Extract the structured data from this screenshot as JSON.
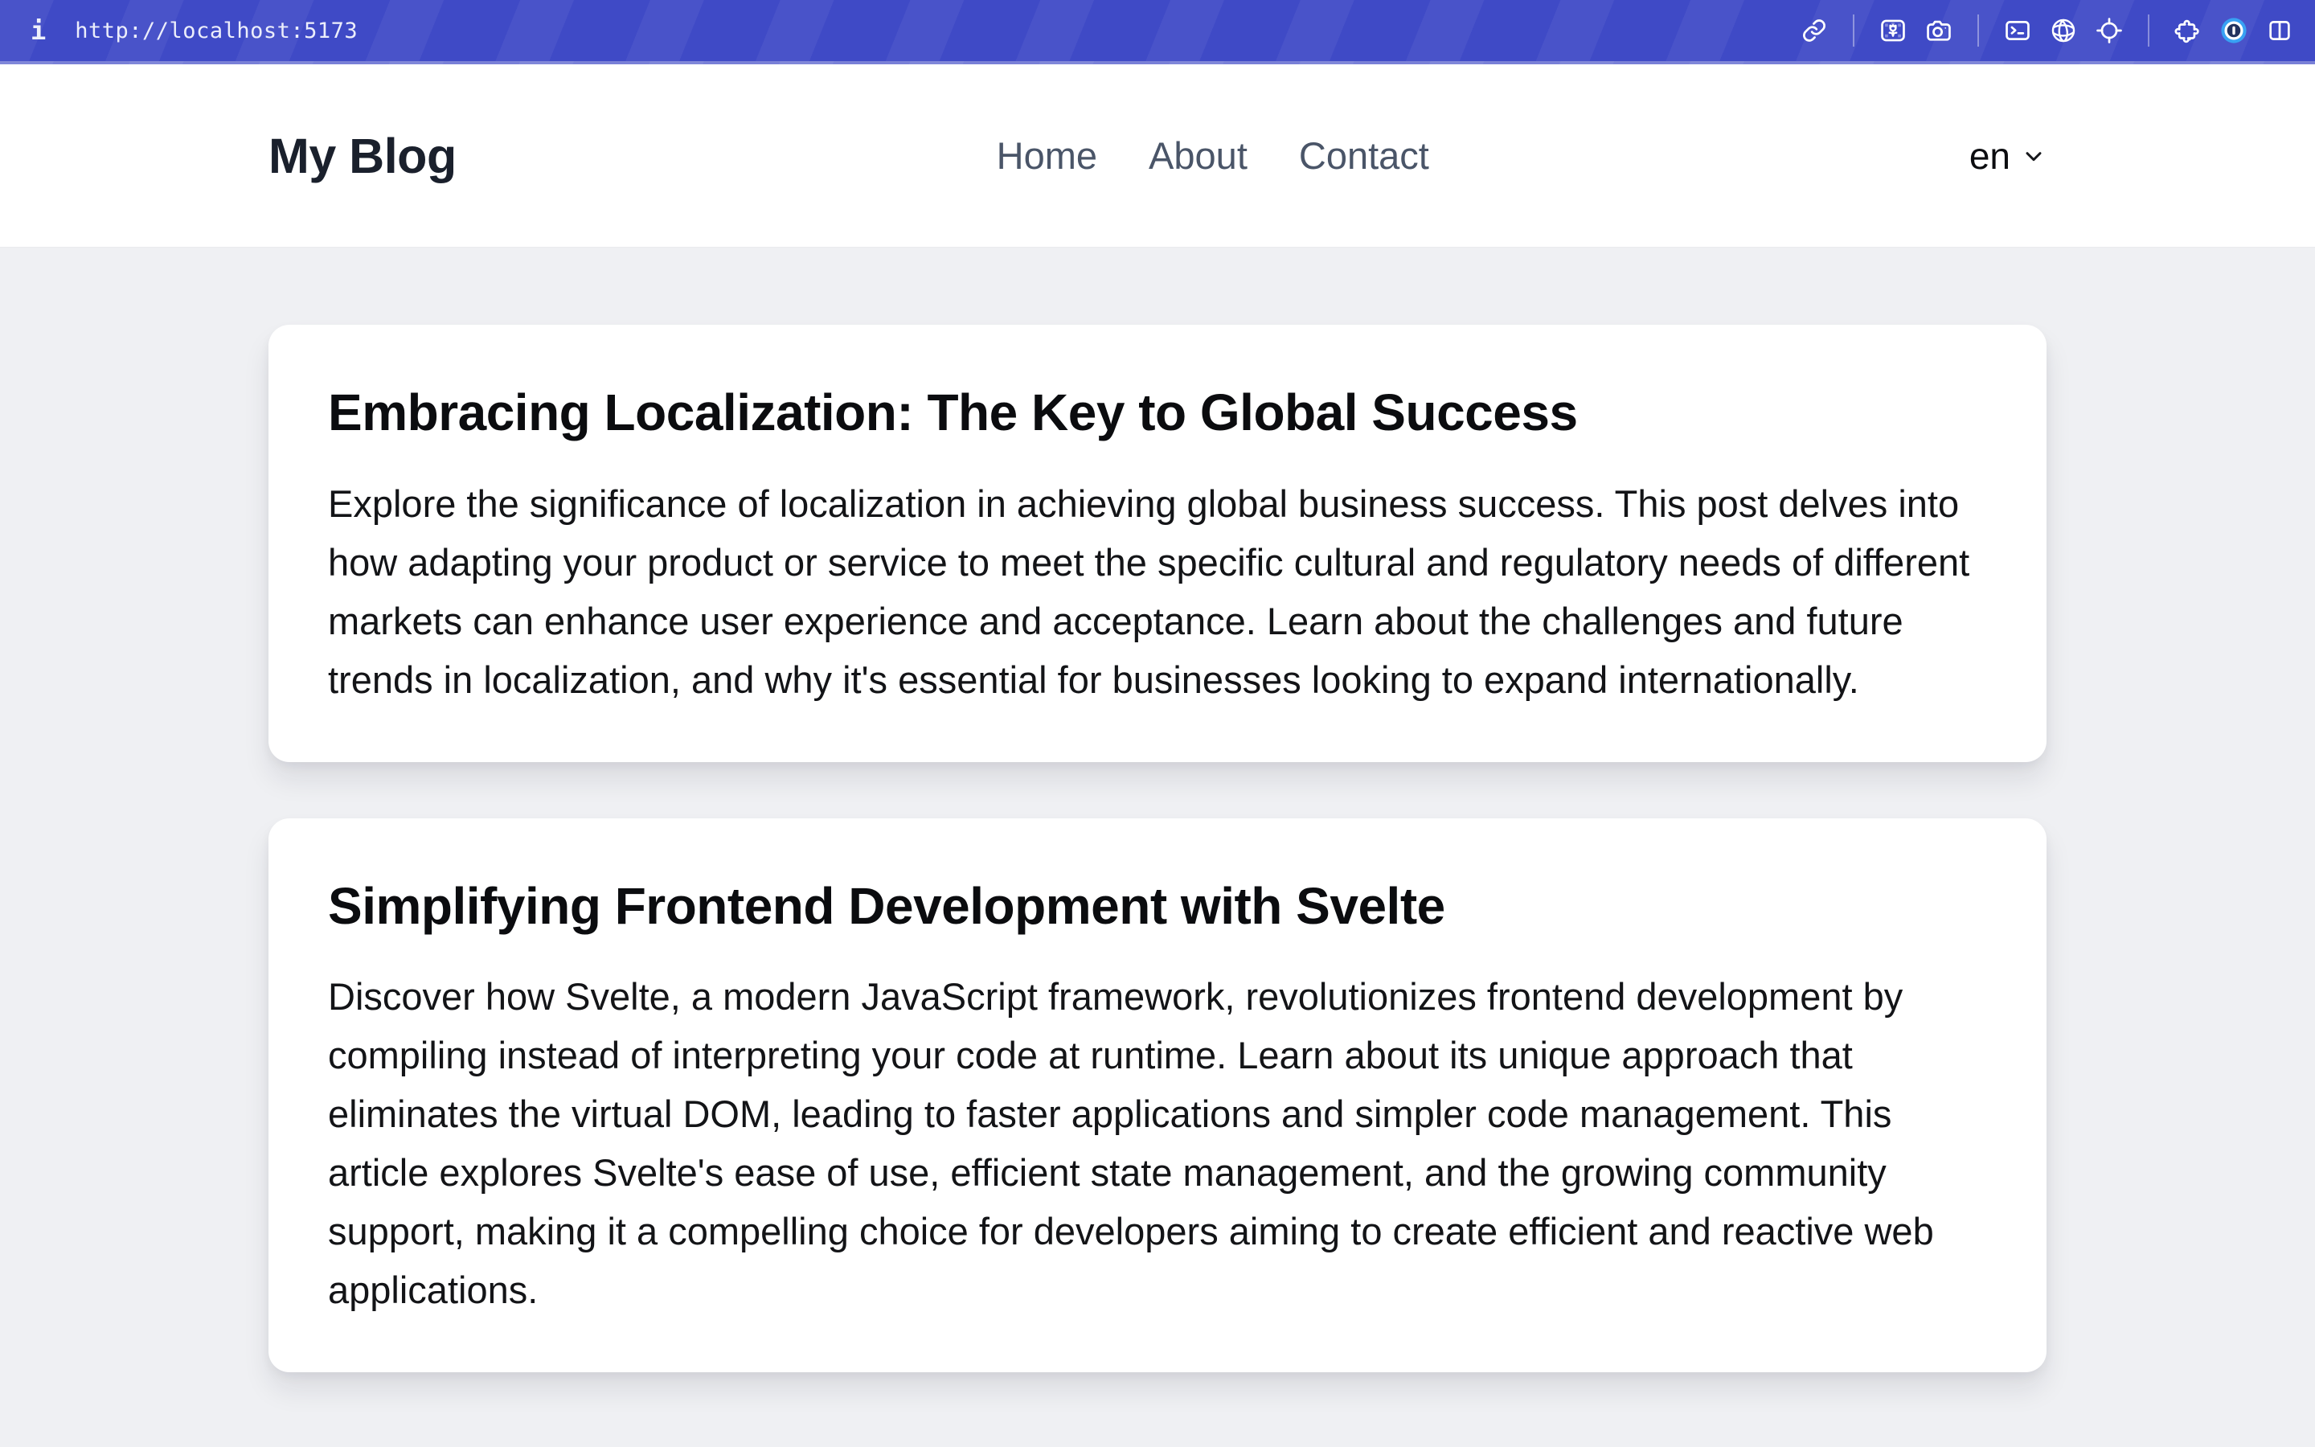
{
  "browser_chrome": {
    "url": "http://localhost:5173",
    "info_glyph": "i",
    "toolbar_icons": [
      "link-icon",
      "wallpaper-image-icon",
      "camera-icon",
      "terminal-icon",
      "globe-icon",
      "crosshair-icon",
      "puzzle-icon",
      "onepassword-icon",
      "split-view-icon"
    ]
  },
  "header": {
    "title": "My Blog",
    "nav": [
      {
        "label": "Home"
      },
      {
        "label": "About"
      },
      {
        "label": "Contact"
      }
    ],
    "language": {
      "selected": "en"
    }
  },
  "posts": [
    {
      "title": "Embracing Localization: The Key to Global Success",
      "excerpt": "Explore the significance of localization in achieving global business success. This post delves into how adapting your product or service to meet the specific cultural and regulatory needs of different markets can enhance user experience and acceptance. Learn about the challenges and future trends in localization, and why it's essential for businesses looking to expand internationally."
    },
    {
      "title": "Simplifying Frontend Development with Svelte",
      "excerpt": "Discover how Svelte, a modern JavaScript framework, revolutionizes frontend development by compiling instead of interpreting your code at runtime. Learn about its unique approach that eliminates the virtual DOM, leading to faster applications and simpler code management. This article explores Svelte's ease of use, efficient state management, and the growing community support, making it a compelling choice for developers aiming to create efficient and reactive web applications."
    }
  ],
  "colors": {
    "page_bg": "#eff0f3",
    "bar_indigo": "#3f4ac6",
    "onepassword_blue": "#38a1f3"
  }
}
